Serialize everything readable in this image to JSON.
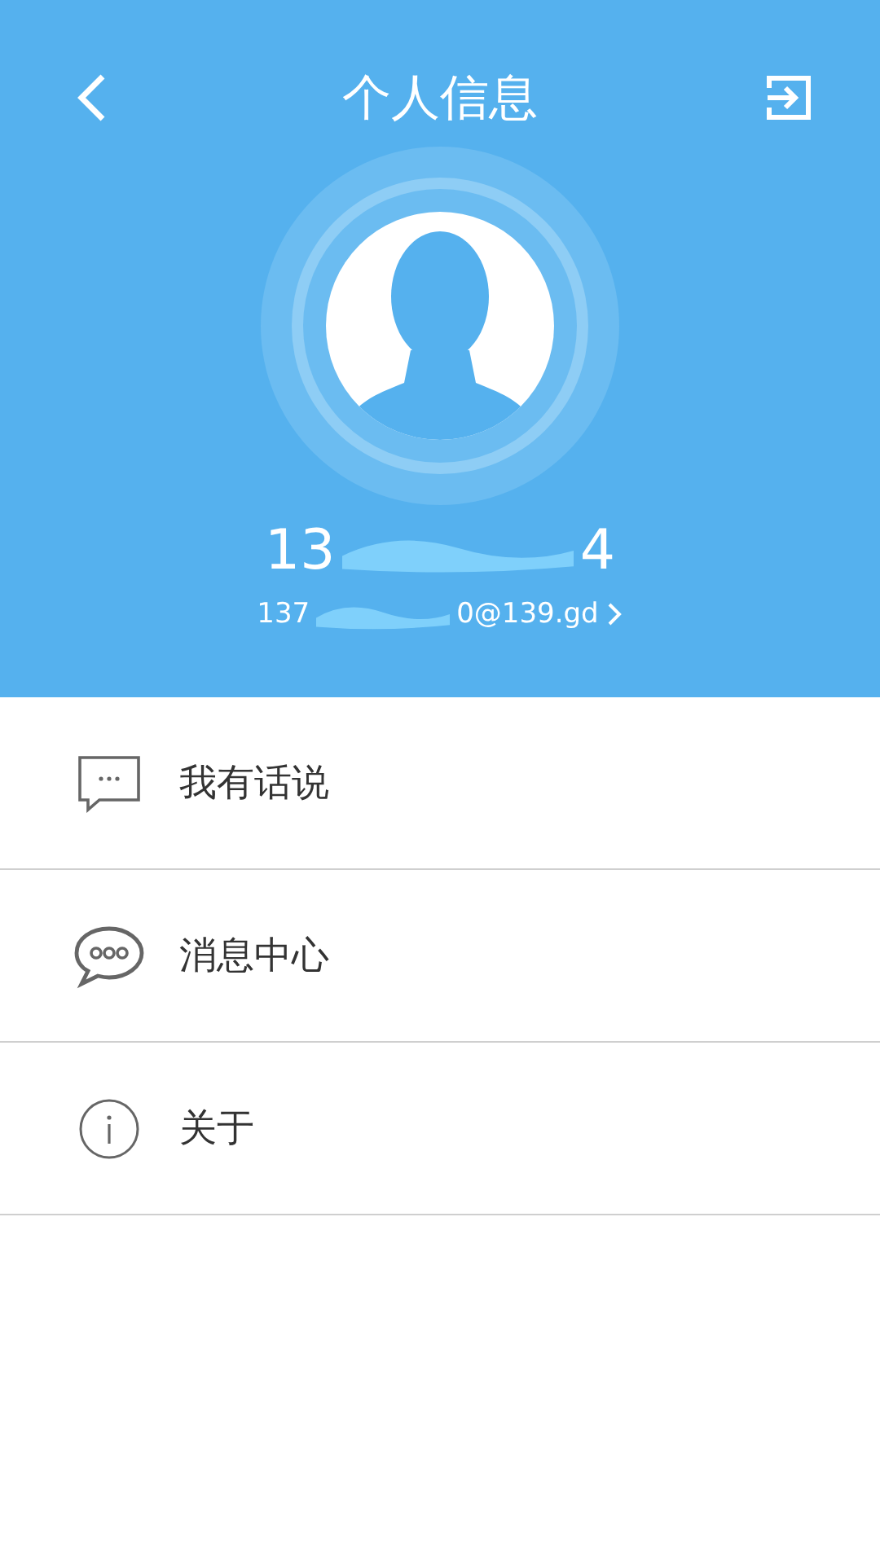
{
  "header": {
    "title": "个人信息"
  },
  "account": {
    "phone_start": "13",
    "phone_end": "4",
    "email_start": "137",
    "email_end": "0@139.gd"
  },
  "menu": [
    {
      "kind": "feedback",
      "label": "我有话说"
    },
    {
      "kind": "messages",
      "label": "消息中心"
    },
    {
      "kind": "about",
      "label": "关于"
    }
  ]
}
